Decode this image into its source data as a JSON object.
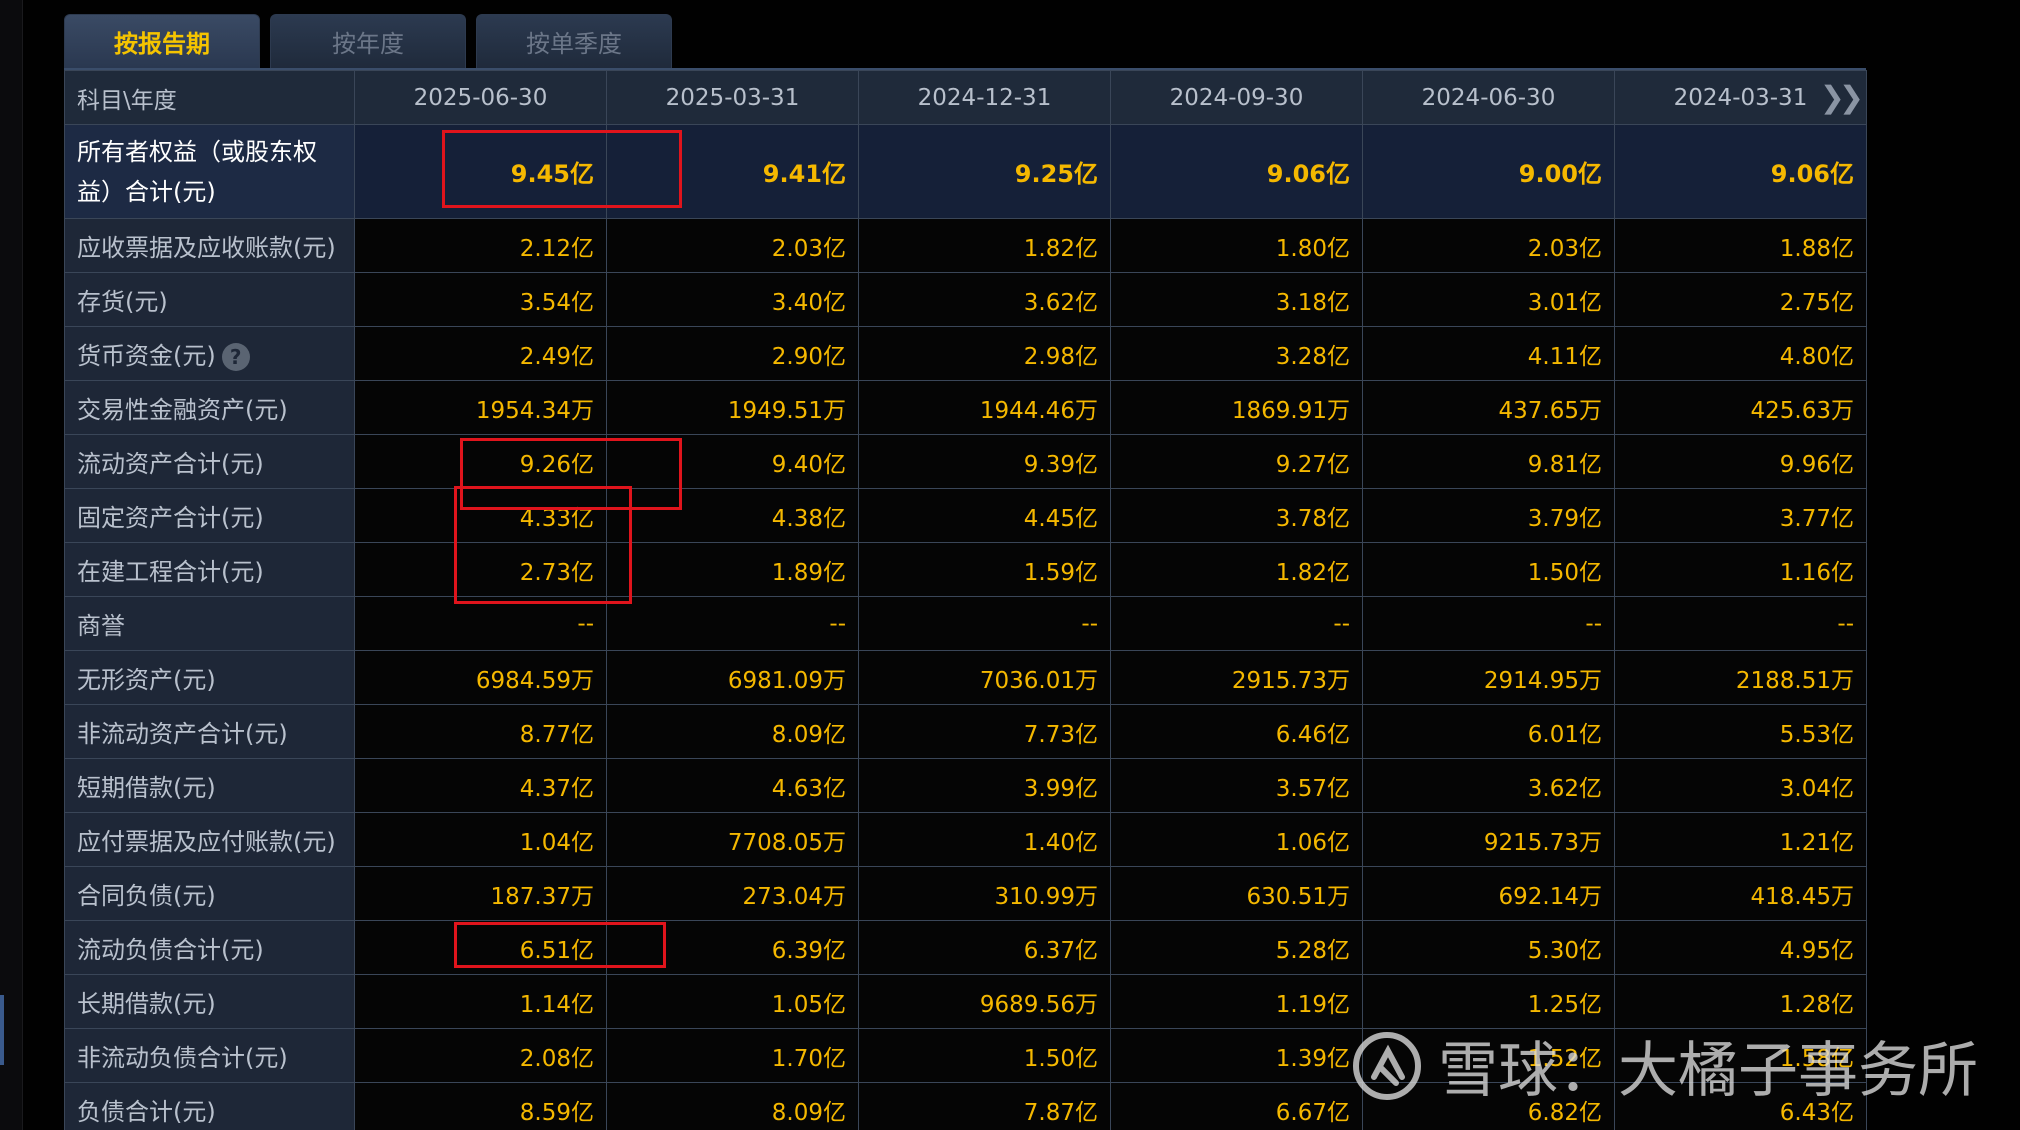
{
  "tabs": [
    {
      "label": "按报告期",
      "active": true
    },
    {
      "label": "按年度",
      "active": false
    },
    {
      "label": "按单季度",
      "active": false
    }
  ],
  "header": {
    "first": "科目\\年度",
    "dates": [
      "2025-06-30",
      "2025-03-31",
      "2024-12-31",
      "2024-09-30",
      "2024-06-30",
      "2024-03-31"
    ],
    "next_icon": "double-chevron-right-icon"
  },
  "rows": [
    {
      "label": "所有者权益（或股东权益）合计(元)",
      "values": [
        "9.45亿",
        "9.41亿",
        "9.25亿",
        "9.06亿",
        "9.00亿",
        "9.06亿"
      ]
    },
    {
      "label": "应收票据及应收账款(元)",
      "values": [
        "2.12亿",
        "2.03亿",
        "1.82亿",
        "1.80亿",
        "2.03亿",
        "1.88亿"
      ]
    },
    {
      "label": "存货(元)",
      "values": [
        "3.54亿",
        "3.40亿",
        "3.62亿",
        "3.18亿",
        "3.01亿",
        "2.75亿"
      ]
    },
    {
      "label": "货币资金(元)",
      "values": [
        "2.49亿",
        "2.90亿",
        "2.98亿",
        "3.28亿",
        "4.11亿",
        "4.80亿"
      ],
      "help": "?"
    },
    {
      "label": "交易性金融资产(元)",
      "values": [
        "1954.34万",
        "1949.51万",
        "1944.46万",
        "1869.91万",
        "437.65万",
        "425.63万"
      ]
    },
    {
      "label": "流动资产合计(元)",
      "values": [
        "9.26亿",
        "9.40亿",
        "9.39亿",
        "9.27亿",
        "9.81亿",
        "9.96亿"
      ]
    },
    {
      "label": "固定资产合计(元)",
      "values": [
        "4.33亿",
        "4.38亿",
        "4.45亿",
        "3.78亿",
        "3.79亿",
        "3.77亿"
      ]
    },
    {
      "label": "在建工程合计(元)",
      "values": [
        "2.73亿",
        "1.89亿",
        "1.59亿",
        "1.82亿",
        "1.50亿",
        "1.16亿"
      ]
    },
    {
      "label": "商誉",
      "values": [
        "--",
        "--",
        "--",
        "--",
        "--",
        "--"
      ]
    },
    {
      "label": "无形资产(元)",
      "values": [
        "6984.59万",
        "6981.09万",
        "7036.01万",
        "2915.73万",
        "2914.95万",
        "2188.51万"
      ]
    },
    {
      "label": "非流动资产合计(元)",
      "values": [
        "8.77亿",
        "8.09亿",
        "7.73亿",
        "6.46亿",
        "6.01亿",
        "5.53亿"
      ]
    },
    {
      "label": "短期借款(元)",
      "values": [
        "4.37亿",
        "4.63亿",
        "3.99亿",
        "3.57亿",
        "3.62亿",
        "3.04亿"
      ]
    },
    {
      "label": "应付票据及应付账款(元)",
      "values": [
        "1.04亿",
        "7708.05万",
        "1.40亿",
        "1.06亿",
        "9215.73万",
        "1.21亿"
      ]
    },
    {
      "label": "合同负债(元)",
      "values": [
        "187.37万",
        "273.04万",
        "310.99万",
        "630.51万",
        "692.14万",
        "418.45万"
      ]
    },
    {
      "label": "流动负债合计(元)",
      "values": [
        "6.51亿",
        "6.39亿",
        "6.37亿",
        "5.28亿",
        "5.30亿",
        "4.95亿"
      ]
    },
    {
      "label": "长期借款(元)",
      "values": [
        "1.14亿",
        "1.05亿",
        "9689.56万",
        "1.19亿",
        "1.25亿",
        "1.28亿"
      ]
    },
    {
      "label": "非流动负债合计(元)",
      "values": [
        "2.08亿",
        "1.70亿",
        "1.50亿",
        "1.39亿",
        "1.52亿",
        "1.58亿"
      ]
    },
    {
      "label": "负债合计(元)",
      "values": [
        "8.59亿",
        "8.09亿",
        "7.87亿",
        "6.67亿",
        "6.82亿",
        "6.43亿"
      ]
    }
  ],
  "watermark": {
    "text": "雪球：大橘子事务所",
    "logo_icon": "snowball-logo-icon"
  },
  "colors": {
    "value_text": "#f5b800",
    "label_bg": "#1e2737",
    "annotation_red": "#e0141c"
  }
}
